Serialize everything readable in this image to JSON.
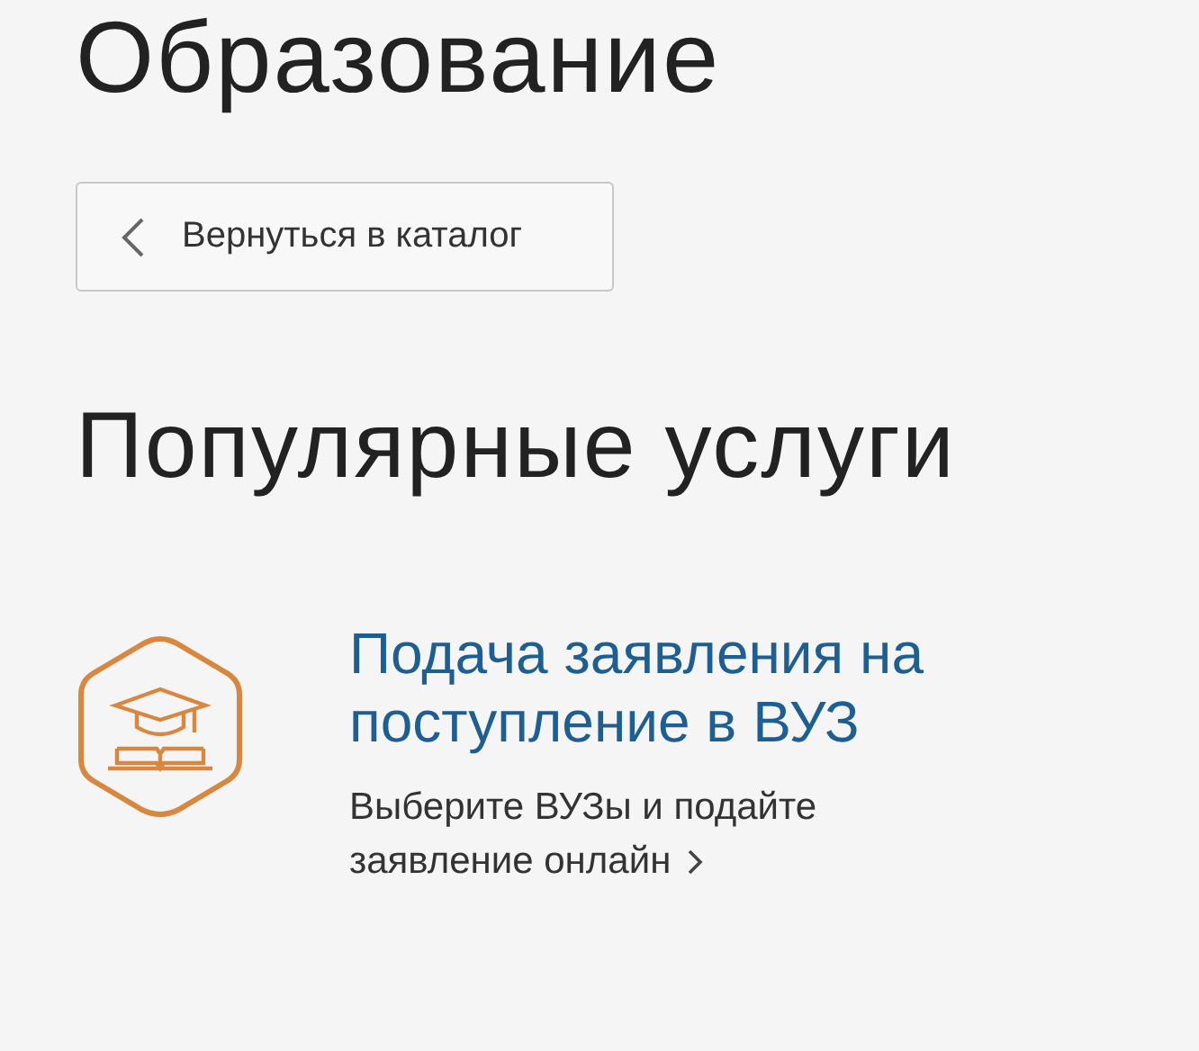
{
  "page_title": "Образование",
  "back_button": {
    "label": "Вернуться в каталог"
  },
  "section_title": "Популярные услуги",
  "services": [
    {
      "title": "Подача заявления на поступление в ВУЗ",
      "description": "Выберите ВУЗы и подайте заявление онлайн"
    }
  ]
}
